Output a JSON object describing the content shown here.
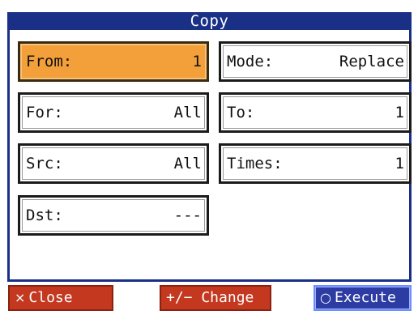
{
  "window": {
    "title": "Copy"
  },
  "fields": {
    "from": {
      "label": "From:",
      "value": "1"
    },
    "mode": {
      "label": "Mode:",
      "value": "Replace"
    },
    "for": {
      "label": "For:",
      "value": "All"
    },
    "to": {
      "label": "To:",
      "value": "1"
    },
    "src": {
      "label": "Src:",
      "value": "All"
    },
    "times": {
      "label": "Times:",
      "value": "1"
    },
    "dst": {
      "label": "Dst:",
      "value": "---"
    }
  },
  "softkeys": {
    "close": {
      "icon": "×",
      "label": "Close"
    },
    "change": {
      "label": "+/− Change"
    },
    "execute": {
      "icon": "○",
      "label": "Execute"
    }
  },
  "colors": {
    "title_bar": "#1a2f86",
    "selected_field": "#f3a03a",
    "red_key": "#c3381f",
    "blue_key": "#2c3ca3"
  }
}
